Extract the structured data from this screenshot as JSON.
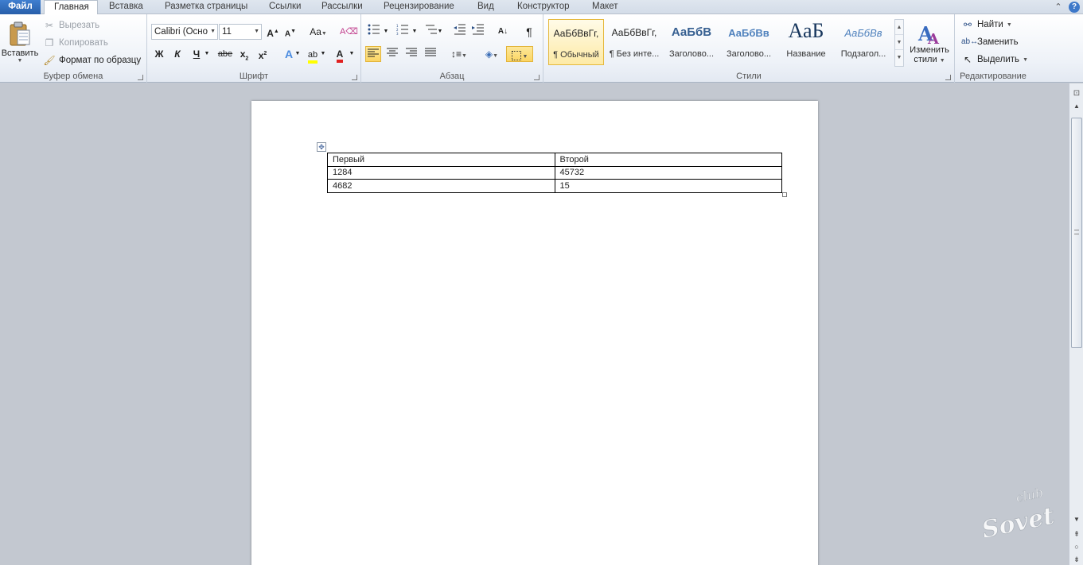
{
  "tabs": {
    "file": "Файл",
    "items": [
      "Главная",
      "Вставка",
      "Разметка страницы",
      "Ссылки",
      "Рассылки",
      "Рецензирование",
      "Вид",
      "Конструктор",
      "Макет"
    ],
    "active_index": 0
  },
  "clipboard": {
    "paste": "Вставить",
    "cut": "Вырезать",
    "copy": "Копировать",
    "format_painter": "Формат по образцу",
    "group_label": "Буфер обмена"
  },
  "font": {
    "font_name": "Calibri (Осно",
    "font_size": "11",
    "case_label": "Aa",
    "bold": "Ж",
    "italic": "К",
    "underline": "Ч",
    "strike": "abe",
    "group_label": "Шрифт"
  },
  "paragraph": {
    "pilcrow": "¶",
    "group_label": "Абзац"
  },
  "styles": {
    "items": [
      {
        "preview": "АаБбВвГг,",
        "name": "¶ Обычный"
      },
      {
        "preview": "АаБбВвГг,",
        "name": "¶ Без инте..."
      },
      {
        "preview": "АаБбВ",
        "name": "Заголово..."
      },
      {
        "preview": "АаБбВв",
        "name": "Заголово..."
      },
      {
        "preview": "АаБ",
        "name": "Название"
      },
      {
        "preview": "АаБбВв",
        "name": "Подзагол..."
      }
    ],
    "change_styles_line1": "Изменить",
    "change_styles_line2": "стили",
    "group_label": "Стили"
  },
  "editing": {
    "find": "Найти",
    "replace": "Заменить",
    "select": "Выделить",
    "group_label": "Редактирование"
  },
  "document": {
    "table": [
      [
        "Первый",
        "Второй"
      ],
      [
        "1284",
        "45732"
      ],
      [
        "4682",
        "15"
      ]
    ]
  },
  "watermark": {
    "text_top": "club",
    "text_main": "Sovet"
  },
  "colors": {
    "file_tab": "#2f6ec0",
    "accent_yellow": "#fbd563",
    "font_color_red": "#e02020",
    "highlight_yellow": "#ffff00"
  }
}
